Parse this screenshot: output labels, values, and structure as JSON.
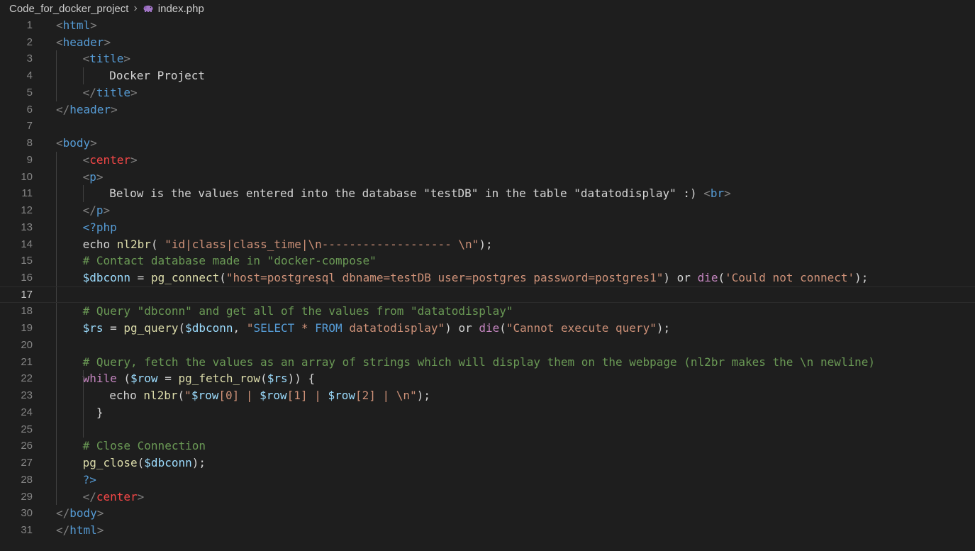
{
  "breadcrumb": {
    "folder": "Code_for_docker_project",
    "separator": "›",
    "file": "index.php",
    "file_icon": "php-elephant-icon"
  },
  "editor": {
    "active_line": 17,
    "lines": [
      {
        "n": "1",
        "indent": 0,
        "tokens": [
          [
            "br",
            "<"
          ],
          [
            "tag",
            "html"
          ],
          [
            "br",
            ">"
          ]
        ]
      },
      {
        "n": "2",
        "indent": 0,
        "tokens": [
          [
            "br",
            "<"
          ],
          [
            "tag",
            "header"
          ],
          [
            "br",
            ">"
          ]
        ]
      },
      {
        "n": "3",
        "indent": 1,
        "tokens": [
          [
            "br",
            "<"
          ],
          [
            "tag",
            "title"
          ],
          [
            "br",
            ">"
          ]
        ]
      },
      {
        "n": "4",
        "indent": 2,
        "tokens": [
          [
            "txt",
            "Docker Project"
          ]
        ]
      },
      {
        "n": "5",
        "indent": 1,
        "tokens": [
          [
            "br",
            "</"
          ],
          [
            "tag",
            "title"
          ],
          [
            "br",
            ">"
          ]
        ]
      },
      {
        "n": "6",
        "indent": 0,
        "tokens": [
          [
            "br",
            "</"
          ],
          [
            "tag",
            "header"
          ],
          [
            "br",
            ">"
          ]
        ]
      },
      {
        "n": "7",
        "indent": 0,
        "tokens": []
      },
      {
        "n": "8",
        "indent": 0,
        "tokens": [
          [
            "br",
            "<"
          ],
          [
            "tag",
            "body"
          ],
          [
            "br",
            ">"
          ]
        ]
      },
      {
        "n": "9",
        "indent": 1,
        "tokens": [
          [
            "br",
            "<"
          ],
          [
            "center",
            "center"
          ],
          [
            "br",
            ">"
          ]
        ]
      },
      {
        "n": "10",
        "indent": 1,
        "tokens": [
          [
            "br",
            "<"
          ],
          [
            "tag",
            "p"
          ],
          [
            "br",
            ">"
          ]
        ]
      },
      {
        "n": "11",
        "indent": 2,
        "tokens": [
          [
            "txt",
            "Below is the values entered into the database \"testDB\" in the table \"datatodisplay\" :) "
          ],
          [
            "br",
            "<"
          ],
          [
            "tag",
            "br"
          ],
          [
            "br",
            ">"
          ]
        ]
      },
      {
        "n": "12",
        "indent": 1,
        "tokens": [
          [
            "br",
            "</"
          ],
          [
            "tag",
            "p"
          ],
          [
            "br",
            ">"
          ]
        ]
      },
      {
        "n": "13",
        "indent": 1,
        "tokens": [
          [
            "php",
            "<?php"
          ]
        ]
      },
      {
        "n": "14",
        "indent": 1,
        "tokens": [
          [
            "txt",
            "echo "
          ],
          [
            "fn",
            "nl2br"
          ],
          [
            "txt",
            "( "
          ],
          [
            "str",
            "\"id|class|class_time|\\n------------------- \\n\""
          ],
          [
            "txt",
            ");"
          ]
        ]
      },
      {
        "n": "15",
        "indent": 1,
        "tokens": [
          [
            "com",
            "# Contact database made in \"docker-compose\""
          ]
        ]
      },
      {
        "n": "16",
        "indent": 1,
        "tokens": [
          [
            "var",
            "$dbconn"
          ],
          [
            "txt",
            " = "
          ],
          [
            "fn",
            "pg_connect"
          ],
          [
            "txt",
            "("
          ],
          [
            "str",
            "\"host=postgresql dbname=testDB user=postgres password=postgres1\""
          ],
          [
            "txt",
            ") or "
          ],
          [
            "kw",
            "die"
          ],
          [
            "txt",
            "("
          ],
          [
            "str",
            "'Could not connect'"
          ],
          [
            "txt",
            ");"
          ]
        ]
      },
      {
        "n": "17",
        "indent": 1,
        "tokens": []
      },
      {
        "n": "18",
        "indent": 1,
        "tokens": [
          [
            "com",
            "# Query \"dbconn\" and get all of the values from \"datatodisplay\""
          ]
        ]
      },
      {
        "n": "19",
        "indent": 1,
        "tokens": [
          [
            "var",
            "$rs"
          ],
          [
            "txt",
            " = "
          ],
          [
            "fn",
            "pg_query"
          ],
          [
            "txt",
            "("
          ],
          [
            "var",
            "$dbconn"
          ],
          [
            "txt",
            ", "
          ],
          [
            "str",
            "\""
          ],
          [
            "sql",
            "SELECT"
          ],
          [
            "str",
            " * "
          ],
          [
            "sql",
            "FROM"
          ],
          [
            "str",
            " datatodisplay\""
          ],
          [
            "txt",
            ") or "
          ],
          [
            "kw",
            "die"
          ],
          [
            "txt",
            "("
          ],
          [
            "str",
            "\"Cannot execute query\""
          ],
          [
            "txt",
            ");"
          ]
        ]
      },
      {
        "n": "20",
        "indent": 1,
        "tokens": []
      },
      {
        "n": "21",
        "indent": 1,
        "tokens": [
          [
            "com",
            "# Query, fetch the values as an array of strings which will display them on the webpage (nl2br makes the \\n newline)"
          ]
        ]
      },
      {
        "n": "22",
        "indent": 1,
        "tokens": [
          [
            "kw",
            "while"
          ],
          [
            "txt",
            " ("
          ],
          [
            "var",
            "$row"
          ],
          [
            "txt",
            " = "
          ],
          [
            "fn",
            "pg_fetch_row"
          ],
          [
            "txt",
            "("
          ],
          [
            "var",
            "$rs"
          ],
          [
            "txt",
            ")) {"
          ]
        ]
      },
      {
        "n": "23",
        "indent": 2,
        "tokens": [
          [
            "txt",
            "echo "
          ],
          [
            "fn",
            "nl2br"
          ],
          [
            "txt",
            "("
          ],
          [
            "str",
            "\""
          ],
          [
            "var",
            "$row"
          ],
          [
            "str",
            "[0] | "
          ],
          [
            "var",
            "$row"
          ],
          [
            "str",
            "[1] | "
          ],
          [
            "var",
            "$row"
          ],
          [
            "str",
            "[2] | \\n\""
          ],
          [
            "txt",
            ");"
          ]
        ]
      },
      {
        "n": "24",
        "indent": 1,
        "tokens": [
          [
            "txt",
            "  }"
          ]
        ]
      },
      {
        "n": "25",
        "indent": 1,
        "tokens": []
      },
      {
        "n": "26",
        "indent": 1,
        "tokens": [
          [
            "com",
            "# Close Connection"
          ]
        ]
      },
      {
        "n": "27",
        "indent": 1,
        "tokens": [
          [
            "fn",
            "pg_close"
          ],
          [
            "txt",
            "("
          ],
          [
            "var",
            "$dbconn"
          ],
          [
            "txt",
            ");"
          ]
        ]
      },
      {
        "n": "28",
        "indent": 1,
        "tokens": [
          [
            "php",
            "?>"
          ]
        ]
      },
      {
        "n": "29",
        "indent": 1,
        "tokens": [
          [
            "br",
            "</"
          ],
          [
            "center",
            "center"
          ],
          [
            "br",
            ">"
          ]
        ]
      },
      {
        "n": "30",
        "indent": 0,
        "tokens": [
          [
            "br",
            "</"
          ],
          [
            "tag",
            "body"
          ],
          [
            "br",
            ">"
          ]
        ]
      },
      {
        "n": "31",
        "indent": 0,
        "tokens": [
          [
            "br",
            "</"
          ],
          [
            "tag",
            "html"
          ],
          [
            "br",
            ">"
          ]
        ]
      }
    ]
  }
}
